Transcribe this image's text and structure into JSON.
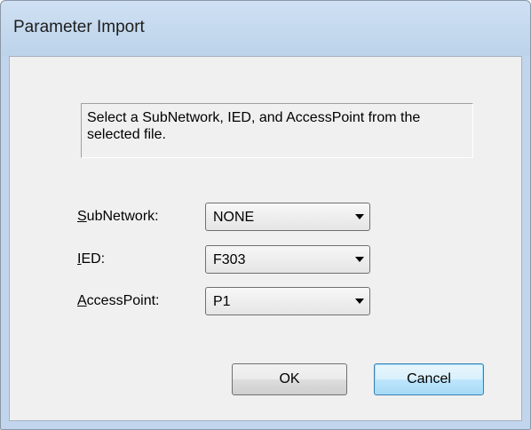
{
  "window": {
    "title": "Parameter Import"
  },
  "message": "Select a SubNetwork, IED, and AccessPoint from the selected file.",
  "fields": {
    "subnetwork": {
      "label_u": "S",
      "label_rest": "ubNetwork:",
      "value": "NONE"
    },
    "ied": {
      "label_u": "I",
      "label_rest": "ED:",
      "value": "F303"
    },
    "accesspoint": {
      "label_u": "A",
      "label_rest": "ccessPoint:",
      "value": "P1"
    }
  },
  "buttons": {
    "ok": "OK",
    "cancel": "Cancel"
  },
  "icons": {
    "dropdown": "chevron-down-icon"
  }
}
